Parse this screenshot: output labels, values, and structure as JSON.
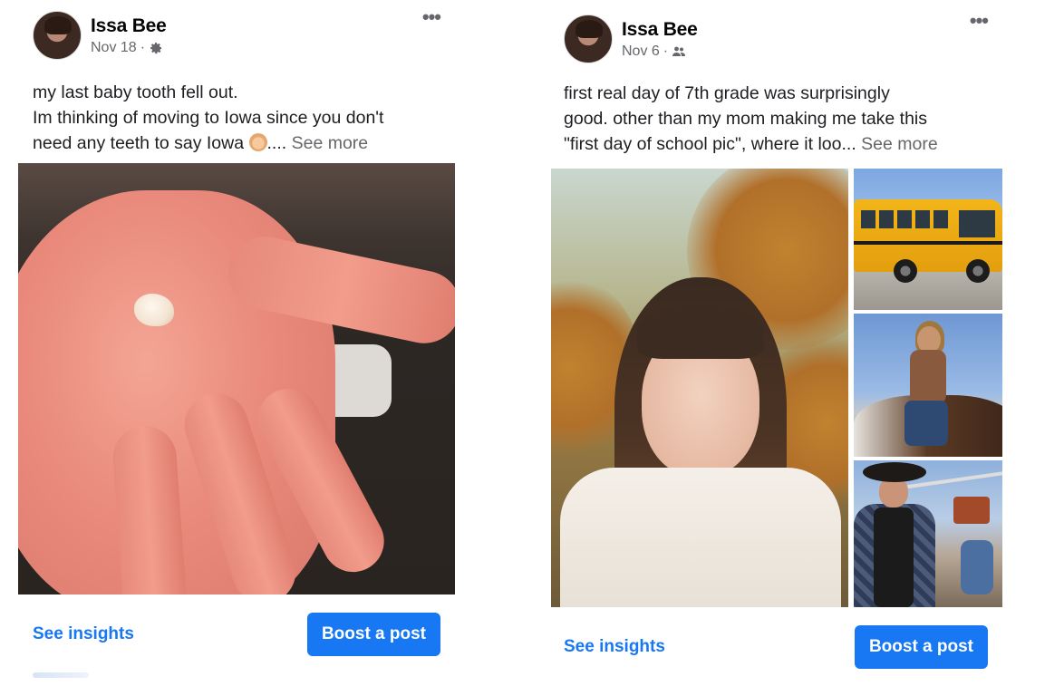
{
  "posts": [
    {
      "author": "Issa Bee",
      "date": "Nov 18",
      "date_separator": "·",
      "audience_icon": "gear-icon",
      "more_label": "•••",
      "text_lines": [
        "my last baby tooth fell out.",
        "Im thinking of moving to Iowa since you don't",
        "need any teeth to say Iowa"
      ],
      "emoji": "baby-face-emoji",
      "ellipsis": "....",
      "see_more": "See more",
      "insights_label": "See insights",
      "boost_label": "Boost a post"
    },
    {
      "author": "Issa Bee",
      "date": "Nov 6",
      "date_separator": "·",
      "audience_icon": "friends-icon",
      "more_label": "•••",
      "text_lines": [
        "first real day of 7th grade was surprisingly",
        "good. other than my mom making me take this",
        "\"first day of school pic\", where it loo..."
      ],
      "see_more": "See more",
      "insights_label": "See insights",
      "boost_label": "Boost a post"
    }
  ],
  "colors": {
    "accent": "#1877f2",
    "secondary_text": "#65676b",
    "primary_text": "#1c1e21"
  }
}
